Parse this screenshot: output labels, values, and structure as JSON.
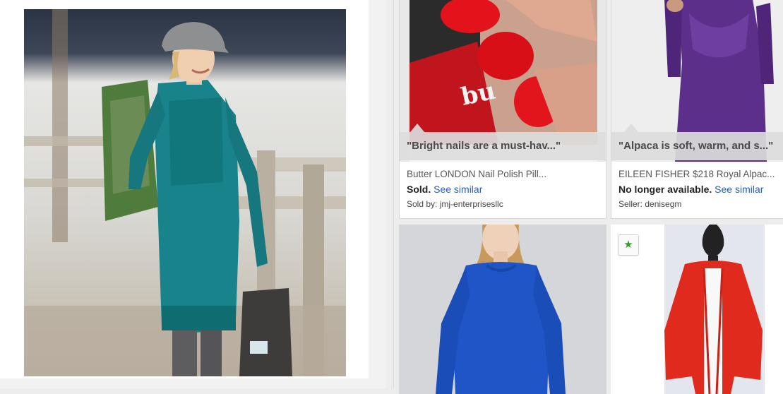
{
  "hero": {
    "image_icon": "photo-woman-teal-sweater-dress"
  },
  "cards": [
    {
      "image_icon": "photo-red-nail-polish",
      "quote": "\"Bright nails are a must-hav...\"",
      "title": "Butter LONDON Nail Polish Pill...",
      "status": "Sold.",
      "link": "See similar",
      "seller": "Sold by: jmj-enterprisesllc"
    },
    {
      "image_icon": "photo-purple-alpaca-sweater",
      "quote": "\"Alpaca is soft, warm, and s...\"",
      "title": "EILEEN FISHER $218 Royal Alpac...",
      "status": "No longer available.",
      "link": "See similar",
      "seller": "Seller: denisegm"
    },
    {
      "image_icon": "photo-blue-sweater"
    },
    {
      "image_icon": "photo-red-cardigan",
      "fav_icon": "star-icon",
      "fav_glyph": "★"
    }
  ],
  "colors": {
    "link": "#2a5db0",
    "star": "#3a9a2a"
  }
}
